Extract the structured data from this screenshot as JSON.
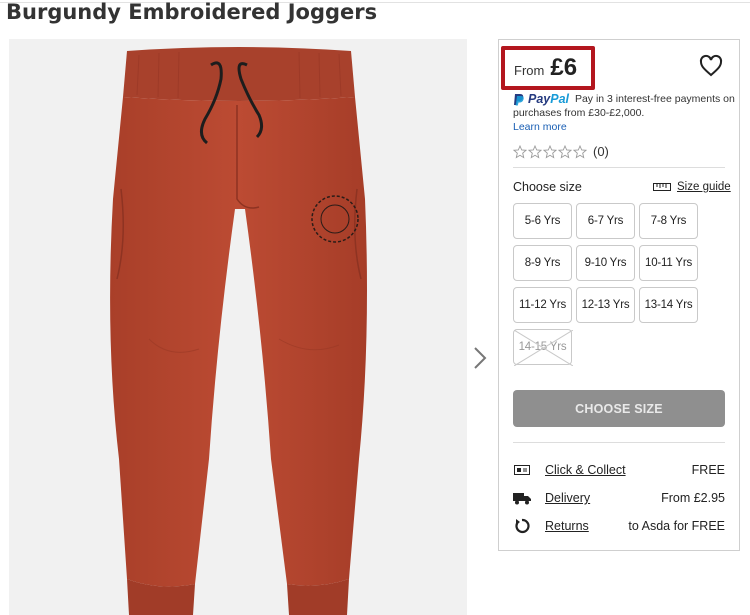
{
  "product": {
    "title": "Burgundy Embroidered Joggers"
  },
  "icons": {
    "wishlist": "heart-outline-icon",
    "next": "chevron-right-icon",
    "size_guide": "ruler-icon",
    "click_collect": "store-collect-icon",
    "delivery": "truck-icon",
    "returns": "return-arrow-icon"
  },
  "colors": {
    "price_highlight": "#b3161e",
    "jogger": "#b8472f",
    "cta_disabled": "#8f8f8f",
    "link": "#1a5fb4"
  },
  "price": {
    "prefix": "From",
    "value": "£6"
  },
  "paypal": {
    "logo_a": "Pay",
    "logo_b": "Pal",
    "text": "Pay in 3 interest-free payments on purchases from £30-£2,000.",
    "learn_more": "Learn more"
  },
  "rating": {
    "count": "(0)",
    "stars": 0
  },
  "sizes": {
    "label": "Choose size",
    "guide": "Size guide",
    "options": [
      {
        "label": "5-6 Yrs",
        "available": true
      },
      {
        "label": "6-7 Yrs",
        "available": true
      },
      {
        "label": "7-8 Yrs",
        "available": true
      },
      {
        "label": "8-9 Yrs",
        "available": true
      },
      {
        "label": "9-10 Yrs",
        "available": true
      },
      {
        "label": "10-11 Yrs",
        "available": true
      },
      {
        "label": "11-12 Yrs",
        "available": true
      },
      {
        "label": "12-13 Yrs",
        "available": true
      },
      {
        "label": "13-14 Yrs",
        "available": true
      },
      {
        "label": "14-15 Yrs",
        "available": false
      }
    ]
  },
  "cta": {
    "label": "CHOOSE SIZE"
  },
  "delivery_options": [
    {
      "label": "Click & Collect",
      "value": "FREE"
    },
    {
      "label": "Delivery",
      "value": "From £2.95"
    },
    {
      "label": "Returns",
      "value": "to Asda for FREE"
    }
  ]
}
